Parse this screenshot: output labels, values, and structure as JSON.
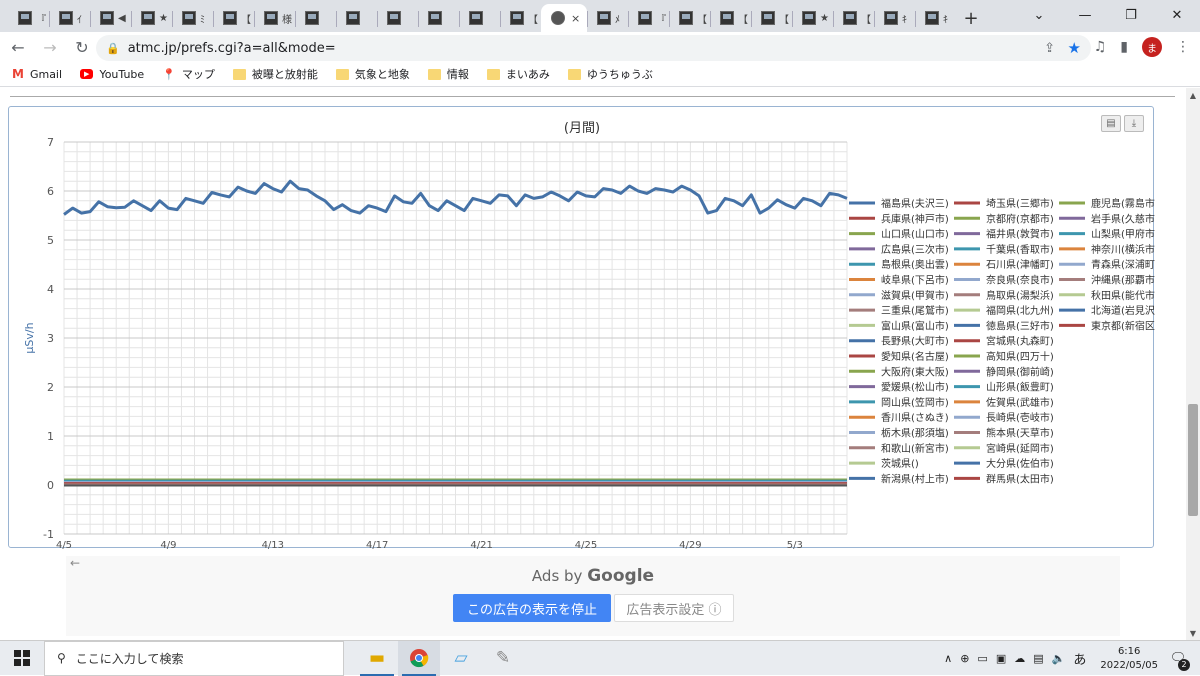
{
  "browser": {
    "url": "atmc.jp/prefs.cgi?a=all&mode=",
    "tabs": [
      {
        "glyph": "『"
      },
      {
        "glyph": "ｲ"
      },
      {
        "glyph": "◀"
      },
      {
        "glyph": "★"
      },
      {
        "glyph": "ﾐ"
      },
      {
        "glyph": "【"
      },
      {
        "glyph": "様"
      },
      {
        "glyph": ""
      },
      {
        "glyph": ""
      },
      {
        "glyph": ""
      },
      {
        "glyph": ""
      },
      {
        "glyph": ""
      },
      {
        "glyph": "【"
      },
      {
        "glyph": "×",
        "active": true
      },
      {
        "glyph": "ﾒ"
      },
      {
        "glyph": "『"
      },
      {
        "glyph": "【"
      },
      {
        "glyph": "【"
      },
      {
        "glyph": "【"
      },
      {
        "glyph": "★"
      },
      {
        "glyph": "【"
      },
      {
        "glyph": "ｷ"
      },
      {
        "glyph": "ｷ"
      }
    ],
    "avatar": "ま"
  },
  "bookmarks": [
    {
      "label": "Gmail",
      "icon": "gmail-icon"
    },
    {
      "label": "YouTube",
      "icon": "youtube-icon"
    },
    {
      "label": "マップ",
      "icon": "maps-icon"
    },
    {
      "label": "被曝と放射能",
      "icon": "folder-icon"
    },
    {
      "label": "気象と地象",
      "icon": "folder-icon"
    },
    {
      "label": "情報",
      "icon": "folder-icon"
    },
    {
      "label": "まいあみ",
      "icon": "folder-icon"
    },
    {
      "label": "ゆうちゅうぶ",
      "icon": "folder-icon"
    }
  ],
  "chart_data": {
    "type": "line",
    "title": "(月間)",
    "xlabel": "",
    "ylabel": "μSv/h",
    "ylim": [
      -1,
      7
    ],
    "yticks": [
      -1,
      0,
      1,
      2,
      3,
      4,
      5,
      6,
      7
    ],
    "xlim": [
      0,
      30
    ],
    "xticks": [
      {
        "x": 0,
        "label": "4/5"
      },
      {
        "x": 4,
        "label": "4/9"
      },
      {
        "x": 8,
        "label": "4/13"
      },
      {
        "x": 12,
        "label": "4/17"
      },
      {
        "x": 16,
        "label": "4/21"
      },
      {
        "x": 20,
        "label": "4/25"
      },
      {
        "x": 24,
        "label": "4/29"
      },
      {
        "x": 28,
        "label": "5/3"
      }
    ],
    "grid": true,
    "legend_position": "right",
    "main_series": {
      "name": "福島県(夫沢三)",
      "color": "#4572a7",
      "values": [
        5.52,
        5.65,
        5.55,
        5.58,
        5.78,
        5.68,
        5.66,
        5.67,
        5.8,
        5.7,
        5.6,
        5.8,
        5.65,
        5.62,
        5.85,
        5.8,
        5.75,
        5.97,
        5.92,
        5.88,
        6.08,
        6.0,
        5.95,
        6.15,
        6.05,
        5.98,
        6.2,
        6.05,
        6.02,
        5.9,
        5.8,
        5.62,
        5.72,
        5.6,
        5.55,
        5.7,
        5.65,
        5.58,
        5.9,
        5.78,
        5.75,
        5.95,
        5.7,
        5.6,
        5.8,
        5.7,
        5.6,
        5.85,
        5.8,
        5.75,
        5.92,
        5.9,
        5.7,
        5.92,
        5.85,
        5.88,
        5.98,
        5.9,
        5.8,
        5.98,
        5.9,
        5.88,
        6.05,
        6.02,
        5.95,
        6.1,
        6.0,
        5.95,
        6.05,
        6.02,
        5.98,
        6.1,
        6.02,
        5.9,
        5.55,
        5.6,
        5.85,
        5.8,
        5.7,
        5.92,
        5.55,
        5.65,
        5.82,
        5.72,
        5.65,
        5.85,
        5.8,
        5.7,
        5.95,
        5.92,
        5.85
      ],
      "x_start": 0,
      "x_end": 30
    },
    "baseline_value": 0.05,
    "series": [
      {
        "name": "福島県(夫沢三)",
        "color": "#4572a7"
      },
      {
        "name": "兵庫県(神戸市)",
        "color": "#aa4643"
      },
      {
        "name": "山口県(山口市)",
        "color": "#89a54e"
      },
      {
        "name": "広島県(三次市)",
        "color": "#80699b"
      },
      {
        "name": "島根県(奥出雲)",
        "color": "#3d96ae"
      },
      {
        "name": "岐阜県(下呂市)",
        "color": "#db843d"
      },
      {
        "name": "滋賀県(甲賀市)",
        "color": "#92a8cd"
      },
      {
        "name": "三重県(尾鷲市)",
        "color": "#a47d7c"
      },
      {
        "name": "富山県(富山市)",
        "color": "#b5ca92"
      },
      {
        "name": "長野県(大町市)",
        "color": "#4572a7"
      },
      {
        "name": "愛知県(名古屋)",
        "color": "#aa4643"
      },
      {
        "name": "大阪府(東大阪)",
        "color": "#89a54e"
      },
      {
        "name": "愛媛県(松山市)",
        "color": "#80699b"
      },
      {
        "name": "岡山県(笠岡市)",
        "color": "#3d96ae"
      },
      {
        "name": "香川県(さぬき)",
        "color": "#db843d"
      },
      {
        "name": "栃木県(那須塩)",
        "color": "#92a8cd"
      },
      {
        "name": "和歌山(新宮市)",
        "color": "#a47d7c"
      },
      {
        "name": "茨城県()",
        "color": "#b5ca92"
      },
      {
        "name": "新潟県(村上市)",
        "color": "#4572a7"
      },
      {
        "name": "埼玉県(三郷市)",
        "color": "#aa4643"
      },
      {
        "name": "京都府(京都市)",
        "color": "#89a54e"
      },
      {
        "name": "福井県(敦賀市)",
        "color": "#80699b"
      },
      {
        "name": "千葉県(香取市)",
        "color": "#3d96ae"
      },
      {
        "name": "石川県(津幡町)",
        "color": "#db843d"
      },
      {
        "name": "奈良県(奈良市)",
        "color": "#92a8cd"
      },
      {
        "name": "鳥取県(湯梨浜)",
        "color": "#a47d7c"
      },
      {
        "name": "福岡県(北九州)",
        "color": "#b5ca92"
      },
      {
        "name": "徳島県(三好市)",
        "color": "#4572a7"
      },
      {
        "name": "宮城県(丸森町)",
        "color": "#aa4643"
      },
      {
        "name": "高知県(四万十)",
        "color": "#89a54e"
      },
      {
        "name": "静岡県(御前崎)",
        "color": "#80699b"
      },
      {
        "name": "山形県(飯豊町)",
        "color": "#3d96ae"
      },
      {
        "name": "佐賀県(武雄市)",
        "color": "#db843d"
      },
      {
        "name": "長崎県(壱岐市)",
        "color": "#92a8cd"
      },
      {
        "name": "熊本県(天草市)",
        "color": "#a47d7c"
      },
      {
        "name": "宮崎県(延岡市)",
        "color": "#b5ca92"
      },
      {
        "name": "大分県(佐伯市)",
        "color": "#4572a7"
      },
      {
        "name": "群馬県(太田市)",
        "color": "#aa4643"
      },
      {
        "name": "鹿児島(霧島市)",
        "color": "#89a54e"
      },
      {
        "name": "岩手県(久慈市)",
        "color": "#80699b"
      },
      {
        "name": "山梨県(甲府市)",
        "color": "#3d96ae"
      },
      {
        "name": "神奈川(横浜市)",
        "color": "#db843d"
      },
      {
        "name": "青森県(深浦町)",
        "color": "#92a8cd"
      },
      {
        "name": "沖縄県(那覇市)",
        "color": "#a47d7c"
      },
      {
        "name": "秋田県(能代市)",
        "color": "#b5ca92"
      },
      {
        "name": "北海道(岩見沢)",
        "color": "#4572a7"
      },
      {
        "name": "東京都(新宿区)",
        "color": "#aa4643"
      }
    ]
  },
  "ads": {
    "back": "←",
    "ads_by": "Ads by",
    "google": "Google",
    "stop_label": "この広告の表示を停止",
    "settings_label": "広告表示設定 ⓘ"
  },
  "taskbar": {
    "search_placeholder": "ここに入力して検索",
    "ime": "あ",
    "time": "6:16",
    "date": "2022/05/05",
    "notifications": "2"
  }
}
